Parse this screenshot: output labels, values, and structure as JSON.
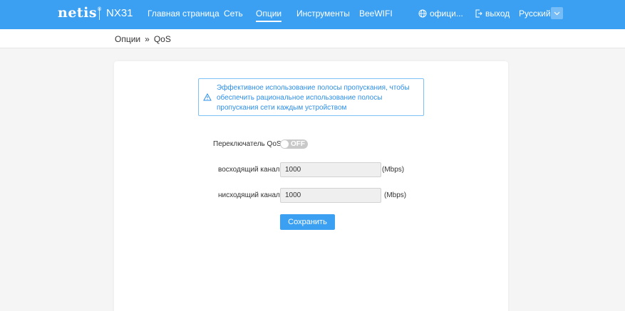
{
  "header": {
    "brand": "netis",
    "brand_mark": "®",
    "model": "NX31",
    "nav": [
      {
        "label": "Главная страница"
      },
      {
        "label": "Сеть"
      },
      {
        "label": "Опции"
      },
      {
        "label": "Инструменты"
      },
      {
        "label": "BeeWIFI"
      }
    ],
    "active_nav": "Опции",
    "website_label": "офици...",
    "logout_label": "выход",
    "language": "Русский"
  },
  "breadcrumb": {
    "parent": "Опции",
    "separator": "»",
    "current": "QoS"
  },
  "notice": {
    "text": "Эффективное использование полосы пропускания, чтобы обеспечить рациональное использование полосы пропускания сети каждым устройством"
  },
  "form": {
    "qos_label": "Переключатель QoS",
    "qos_state": "OFF",
    "upstream_label": "восходящий канал",
    "upstream_value": "1000",
    "upstream_unit": "(Mbps)",
    "downstream_label": "нисходящий канал",
    "downstream_value": "1000",
    "downstream_unit": "(Mbps)",
    "save_label": "Сохранить"
  },
  "colors": {
    "accent": "#3ba0f2",
    "notice_text": "#2d8fe8",
    "toggle_off": "#c9c9c9"
  }
}
